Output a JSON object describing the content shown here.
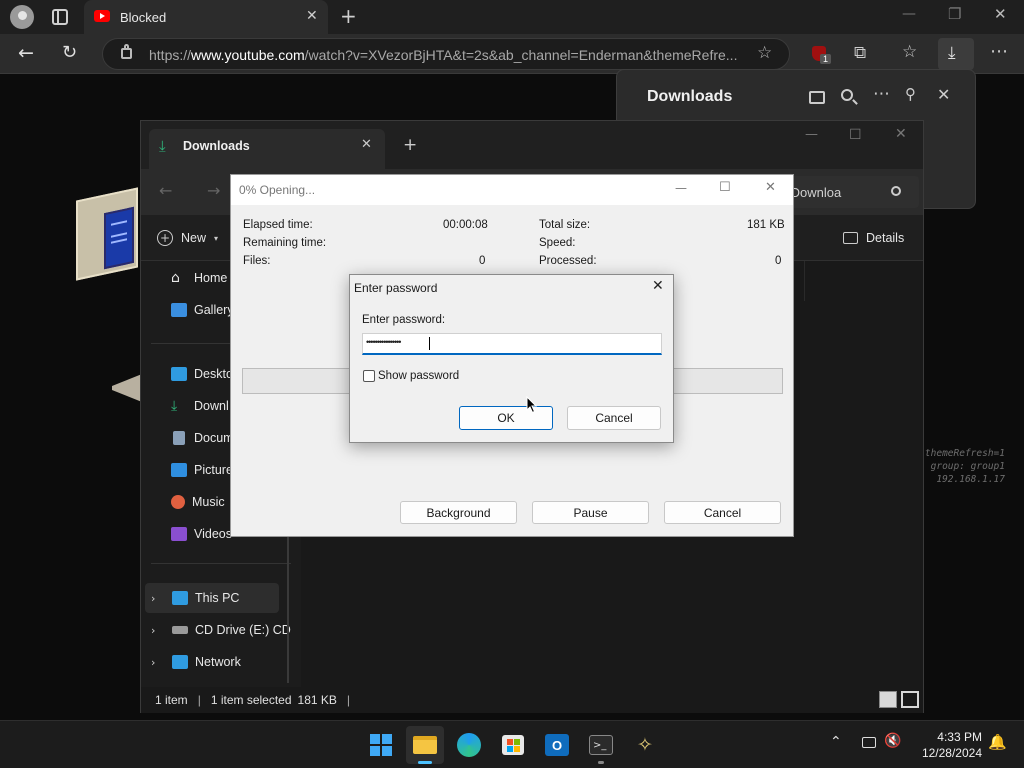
{
  "browser": {
    "tab_title": "Blocked",
    "url_prefix": "https://",
    "url_host": "www.youtube.com",
    "url_path": "/watch?v=XVezorBjHTA&t=2s&ab_channel=Enderman&themeRefre...",
    "extension_badge": "1",
    "downloads_panel_title": "Downloads",
    "accent": "#ff0000"
  },
  "terminal_lines": [
    "themeRefresh=1",
    "group: group1",
    "192.168.1.17"
  ],
  "explorer": {
    "tab_title": "Downloads",
    "search_placeholder": "rch Downloa",
    "new_label": "New",
    "details_label": "Details",
    "sidebar": [
      {
        "label": "Home",
        "icon": "home-icon",
        "color": "#e8e8e8"
      },
      {
        "label": "Gallery",
        "icon": "gallery-icon",
        "color": "#3a8fe0"
      },
      {
        "label": "Deskto",
        "icon": "desktop-icon",
        "color": "#2f9be0"
      },
      {
        "label": "Downl",
        "icon": "download-folder-icon",
        "color": "#2fb37a"
      },
      {
        "label": "Docum",
        "icon": "documents-icon",
        "color": "#8aa0b8"
      },
      {
        "label": "Picture",
        "icon": "pictures-icon",
        "color": "#2f8fe0"
      },
      {
        "label": "Music",
        "icon": "music-icon",
        "color": "#e06040"
      },
      {
        "label": "Videos",
        "icon": "videos-icon",
        "color": "#8a4fd0"
      }
    ],
    "tree": [
      {
        "label": "This PC",
        "icon": "this-pc-icon"
      },
      {
        "label": "CD Drive (E:) CD",
        "icon": "cd-drive-icon"
      },
      {
        "label": "Network",
        "icon": "network-icon"
      }
    ],
    "status_items": "1 item",
    "status_selected": "1 item selected",
    "status_size": "181 KB"
  },
  "progress": {
    "title": "0% Opening...",
    "elapsed_label": "Elapsed time:",
    "elapsed_value": "00:00:08",
    "remaining_label": "Remaining time:",
    "files_label": "Files:",
    "files_value": "0",
    "total_label": "Total size:",
    "total_value": "181 KB",
    "speed_label": "Speed:",
    "processed_label": "Processed:",
    "processed_value": "0",
    "percent": 0,
    "background_btn": "Background",
    "pause_btn": "Pause",
    "cancel_btn": "Cancel"
  },
  "password_dialog": {
    "title": "Enter password",
    "label": "Enter password:",
    "value": "••••••••••••••••",
    "show_password_label": "Show password",
    "show_password_checked": false,
    "ok_label": "OK",
    "cancel_label": "Cancel"
  },
  "taskbar": {
    "time": "4:33 PM",
    "date": "12/28/2024"
  }
}
